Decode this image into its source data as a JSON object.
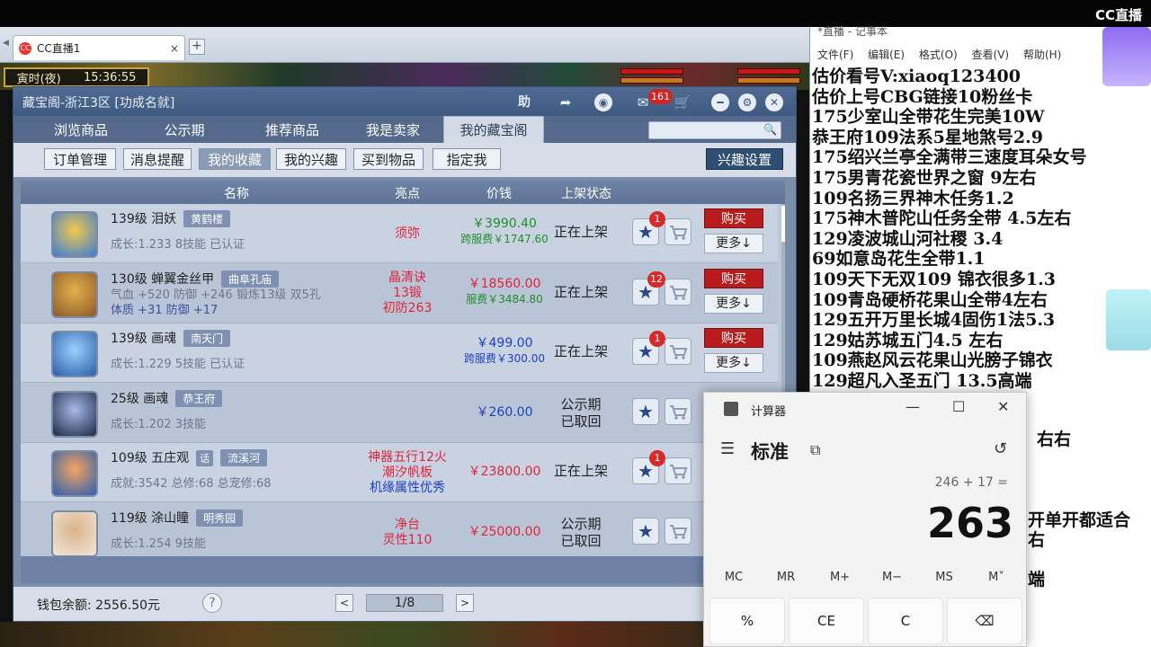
{
  "stream": {
    "logo_text": "CC直播"
  },
  "browser": {
    "tab_title": "CC直播1",
    "new_tab": "+",
    "close": "×"
  },
  "game": {
    "time_label": "寅时(夜)",
    "clock": "15:36:55"
  },
  "window": {
    "title": "藏宝阁-浙江3区 [功成名就]",
    "help": "助",
    "mail_count": "161",
    "tabs": [
      "浏览商品",
      "公示期",
      "推荐商品",
      "我是卖家",
      "我的藏宝阁"
    ],
    "active_tab": "我的藏宝阁",
    "search_placeholder": "",
    "subtabs": [
      "订单管理",
      "消息提醒",
      "我的收藏",
      "我的兴趣",
      "买到物品",
      "指定我"
    ],
    "active_subtab": "我的收藏",
    "interest_settings": "兴趣设置",
    "columns": [
      "名称",
      "亮点",
      "价钱",
      "上架状态"
    ],
    "buy_label": "购买",
    "more_label": "更多↓",
    "wallet": "钱包余额: 2556.50元",
    "help_icon": "?",
    "prev": "<",
    "next": ">",
    "page": "1/8"
  },
  "rows": [
    {
      "name": "139级  泪妖",
      "server": "黄鹤楼",
      "extra": "",
      "info": "成长:1.233 8技能 已认证",
      "info2": "",
      "highlights": [
        "须弥"
      ],
      "hl_colors": [
        "#e0243a"
      ],
      "price": "￥3990.40",
      "price_color": "#1f8f2a",
      "cross": "跨服费￥1747.60",
      "cross_color": "#1f8f2a",
      "status": "正在上架",
      "fav_badge": "1",
      "buy": true
    },
    {
      "name": "130级  蝉翼金丝甲",
      "server": "曲阜孔庙",
      "extra": "",
      "info": "气血 +520 防御 +246 锻炼13级 双5孔",
      "info2": "体质 +31 防御 +17",
      "highlights": [
        "晶清诀",
        "13锻",
        "初防263"
      ],
      "hl_colors": [
        "#e0243a",
        "#e0243a",
        "#e0243a"
      ],
      "price": "￥18560.00",
      "price_color": "#e0243a",
      "cross": "服费￥3484.80",
      "cross_color": "#1f8f2a",
      "status": "正在上架",
      "fav_badge": "12",
      "buy": true
    },
    {
      "name": "139级  画魂",
      "server": "南天门",
      "extra": "",
      "info": "成长:1.229 5技能 已认证",
      "info2": "",
      "highlights": [],
      "hl_colors": [],
      "price": "￥499.00",
      "price_color": "#1f3fc0",
      "cross": "跨服费￥300.00",
      "cross_color": "#1f3fc0",
      "status": "正在上架",
      "fav_badge": "1",
      "buy": true
    },
    {
      "name": "25级  画魂",
      "server": "恭王府",
      "extra": "",
      "info": "成长:1.202 3技能",
      "info2": "",
      "highlights": [],
      "hl_colors": [],
      "price": "￥260.00",
      "price_color": "#1f3fc0",
      "cross": "",
      "cross_color": "#1f3fc0",
      "status": "公示期\n已取回",
      "fav_badge": "",
      "buy": false
    },
    {
      "name": "109级  五庄观",
      "server": "流溪河",
      "extra": "话",
      "info": "成就:3542 总修:68 总宠修:68",
      "info2": "",
      "highlights": [
        "神器五行12火",
        "潮汐帆板",
        "机缘属性优秀"
      ],
      "hl_colors": [
        "#e0243a",
        "#e0243a",
        "#1f3fc0"
      ],
      "price": "￥23800.00",
      "price_color": "#e0243a",
      "cross": "",
      "cross_color": "#e0243a",
      "status": "正在上架",
      "fav_badge": "1",
      "buy": false
    },
    {
      "name": "119级  涂山瞳",
      "server": "明秀园",
      "extra": "",
      "info": "成长:1.254 9技能",
      "info2": "",
      "highlights": [
        "净台",
        "灵性110"
      ],
      "hl_colors": [
        "#e0243a",
        "#e0243a"
      ],
      "price": "￥25000.00",
      "price_color": "#e0243a",
      "cross": "",
      "cross_color": "#e0243a",
      "status": "公示期\n已取回",
      "fav_badge": "",
      "buy": false
    }
  ],
  "notepad": {
    "title": "*直播 - 记事本",
    "menu": [
      "文件(F)",
      "编辑(E)",
      "格式(O)",
      "查看(V)",
      "帮助(H)"
    ],
    "lines": [
      "估价看号V:xiaoq123400",
      "估价上号CBG链接10粉丝卡",
      "175少室山全带花生完美10W",
      "恭王府109法系5星地煞号2.9",
      "175绍兴兰亭全满带三速度耳朵女号",
      "175男青花瓷世界之窗  9左右",
      "109名扬三界神木任务1.2",
      "175神木普陀山任务全带 4.5左右",
      "129凌波城山河社稷  3.4",
      "69如意岛花生全带1.1",
      "109天下无双109  锦衣很多1.3",
      "109青岛硬桥花果山全带4左右",
      "129五开万里长城4固伤1法5.3",
      "129姑苏城五门4.5 左右",
      "109燕赵风云花果山光膀子锦衣",
      "129超凡入圣五门  13.5高端"
    ],
    "frag1": "右右",
    "frag2": "开单开都适合",
    "frag3": "右",
    "frag4": "端"
  },
  "calculator": {
    "title": "计算器",
    "mode": "标准",
    "expression": "246 + 17 =",
    "display": "263",
    "memory": [
      "MC",
      "MR",
      "M+",
      "M−",
      "MS",
      "M˅"
    ],
    "buttons": [
      "%",
      "CE",
      "C",
      "⌫"
    ]
  }
}
